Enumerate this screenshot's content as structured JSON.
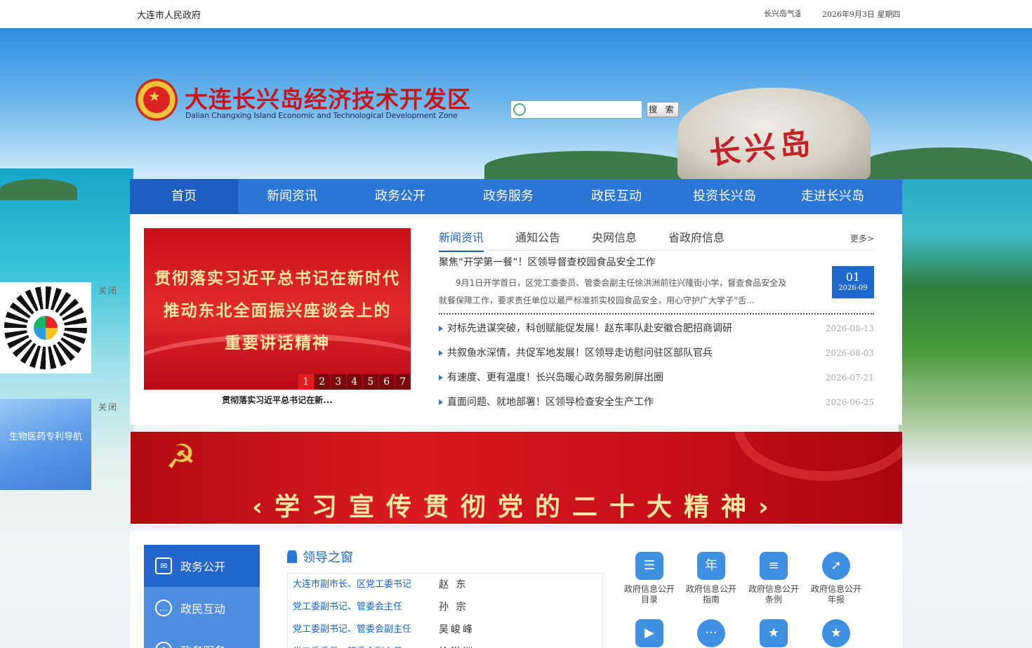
{
  "topbar": {
    "site_name": "大连市人民政府",
    "weather": "长兴岛气温",
    "date": "2026年9月3日  星期四"
  },
  "header": {
    "title_cn": "大连长兴岛经济技术开发区",
    "title_en": "Dalian Changxing Island Economic and Technological Development Zone",
    "rock_text": "长兴岛"
  },
  "search": {
    "placeholder": "",
    "button_label": "搜 索"
  },
  "nav": {
    "items": [
      "首页",
      "新闻资讯",
      "政务公开",
      "政务服务",
      "政民互动",
      "投资长兴岛",
      "走进长兴岛"
    ],
    "active": "首页"
  },
  "slideshow": {
    "lines": [
      "贯彻落实习近平总书记在新时代",
      "推动东北全面振兴座谈会上的",
      "重要讲话精神"
    ],
    "pages": [
      "1",
      "2",
      "3",
      "4",
      "5",
      "6",
      "7"
    ],
    "active_page": "1",
    "caption": "贯彻落实习近平总书记在新..."
  },
  "news": {
    "tabs": [
      "新闻资讯",
      "通知公告",
      "央网信息",
      "省政府信息"
    ],
    "active_tab": "新闻资讯",
    "more": "更多>",
    "headline": "聚焦“开学第一餐”！区领导督查校园食品安全工作",
    "summary": "9月1日开学首日，区党工委委员、管委会副主任徐洪洲前往兴隆街小学，督查食品安全及就餐保障工作，要求责任单位以最严标准抓实校园食品安全，用心守护广大学子“舌...",
    "headline_day": "01",
    "headline_month": "2026-09",
    "items": [
      {
        "title": "对标先进谋突破，科创赋能促发展！赵东率队赴安徽合肥招商调研",
        "date": "2026-08-13"
      },
      {
        "title": "共叙鱼水深情，共促军地发展！区领导走访慰问驻区部队官兵",
        "date": "2026-08-03"
      },
      {
        "title": "有速度、更有温度！长兴岛暖心政务服务刷屏出圈",
        "date": "2026-07-21"
      },
      {
        "title": "直面问题、就地部署！区领导检查安全生产工作",
        "date": "2026-06-25"
      }
    ]
  },
  "floats": {
    "close1": "关闭",
    "close2": "关闭",
    "bio_label": "生物医药专利导航"
  },
  "banner": {
    "text": "‹学习宣传贯彻党的二十大精神›"
  },
  "sidemenu": {
    "items": [
      "政务公开",
      "政民互动",
      "政务服务"
    ]
  },
  "leaders": {
    "title": "领导之窗",
    "rows": [
      {
        "position": "大连市副市长、区党工委书记",
        "name": "赵 东"
      },
      {
        "position": "党工委副书记、管委会主任",
        "name": "孙 宗"
      },
      {
        "position": "党工委副书记、管委会副主任",
        "name": "吴峻峰"
      },
      {
        "position": "党工委委员、管委会副主任",
        "name": "徐洪洲"
      }
    ]
  },
  "quick_icons": {
    "items": [
      {
        "label_1": "政府信息公开",
        "label_2": "目录",
        "icon": "list-icon",
        "glyph": "☰"
      },
      {
        "label_1": "政府信息公开",
        "label_2": "指南",
        "icon": "calendar-icon",
        "glyph": "年"
      },
      {
        "label_1": "政府信息公开",
        "label_2": "条例",
        "icon": "document-icon",
        "glyph": "≡"
      },
      {
        "label_1": "政府信息公开",
        "label_2": "年报",
        "icon": "compass-icon",
        "glyph": "➚"
      },
      {
        "label_1": "",
        "label_2": "",
        "icon": "video-icon",
        "glyph": "▶"
      },
      {
        "label_1": "",
        "label_2": "",
        "icon": "chat-icon",
        "glyph": "···"
      },
      {
        "label_1": "",
        "label_2": "",
        "icon": "badge-icon",
        "glyph": "★"
      },
      {
        "label_1": "",
        "label_2": "",
        "icon": "medal-icon",
        "glyph": "★"
      }
    ]
  },
  "colors": {
    "nav_blue": "#2b75d6",
    "accent_red": "#c8161d",
    "link_blue": "#1b63c6"
  }
}
